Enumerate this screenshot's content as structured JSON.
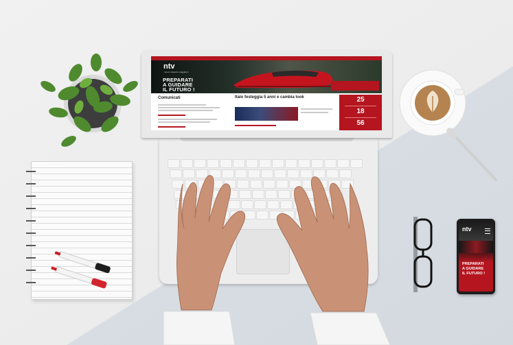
{
  "laptop_screen": {
    "logo": "ntv",
    "logo_subtext": "nuovo trasporto viaggiatori",
    "hero_title_lines": [
      "PREPARATI",
      "A GUIDARE",
      "IL FUTURO !"
    ],
    "hero_cta": "",
    "left_heading": "Comunicati",
    "middle_heading": "Italo festeggia 5 anni e cambia look",
    "stats": [
      "25",
      "18",
      "56"
    ]
  },
  "phone_screen": {
    "logo": "ntv",
    "title_lines": [
      "PREPARATI",
      "A GUIDARE",
      "IL FUTURO !"
    ]
  },
  "colors": {
    "brand_red": "#b4151f",
    "desk_light": "#f1f1f1",
    "desk_blue": "#d3d9df"
  }
}
